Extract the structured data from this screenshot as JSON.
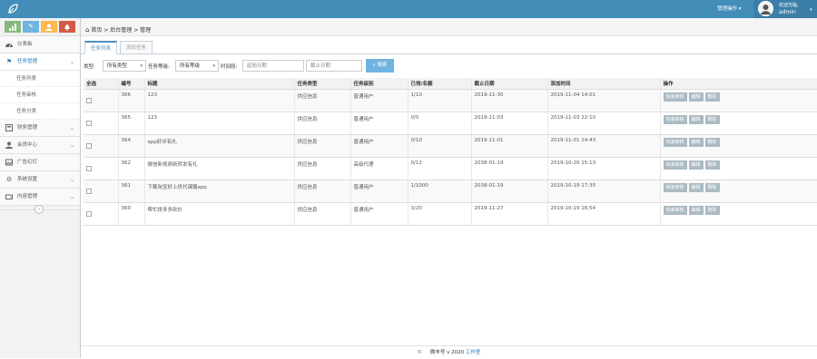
{
  "topbar": {
    "logo_icon": "leaf-icon",
    "admin_menu": "管理操作",
    "user_greeting": "欢迎光临,",
    "user_name": "admin"
  },
  "shortcuts": [
    {
      "icon": "signal-icon",
      "color": "#87b87f"
    },
    {
      "icon": "pencil-icon",
      "color": "#6fb3e0"
    },
    {
      "icon": "users-icon",
      "color": "#ffb752"
    },
    {
      "icon": "bell-icon",
      "color": "#d15b47"
    }
  ],
  "sidebar": {
    "dashboard": "仪表板",
    "task_mgmt": "任务管理",
    "task_list": "任务列表",
    "task_review": "任务审核",
    "task_category": "任务分类",
    "finance": "财务管理",
    "members": "会员中心",
    "ads": "广告幻灯",
    "settings": "系统设置",
    "content": "内容管理"
  },
  "breadcrumb": {
    "home": "首页",
    "sep": ">",
    "backend": "后台管理",
    "current": "管理"
  },
  "tabs": {
    "task_list": "任务列表",
    "add_task": "添加任务"
  },
  "filter": {
    "type_label": "类型:",
    "type_value": "所有类型",
    "level_label": "任务等级:",
    "level_value": "所有等级",
    "time_label": "时间段:",
    "start_placeholder": "起始日期",
    "end_placeholder": "截止日期",
    "search_button": "搜索"
  },
  "table": {
    "headers": {
      "select_all": "全选",
      "id": "编号",
      "title": "标题",
      "type": "任务类型",
      "level": "任务级别",
      "claimed": "已领/名额",
      "deadline": "截止日期",
      "added": "添加时间",
      "ops": "操作"
    },
    "rows": [
      {
        "id": "366",
        "title": "123",
        "type": "供应信息",
        "level": "普通用户",
        "claimed": "1/10",
        "deadline": "2019-11-30",
        "added": "2019-11-04 14:01"
      },
      {
        "id": "365",
        "title": "123",
        "type": "供应信息",
        "level": "普通用户",
        "claimed": "0/5",
        "deadline": "2019-11-03",
        "added": "2019-11-03 22:10"
      },
      {
        "id": "364",
        "title": "app好评有礼",
        "type": "供应信息",
        "level": "普通用户",
        "claimed": "0/10",
        "deadline": "2019-11-01",
        "added": "2019-11-01 14:43"
      },
      {
        "id": "362",
        "title": "微信新视频新转发有礼",
        "type": "供应信息",
        "level": "高级代理",
        "claimed": "0/12",
        "deadline": "2038-01-19",
        "added": "2019-10-20 15:13"
      },
      {
        "id": "361",
        "title": "下载淘宝好上供代课赠app",
        "type": "供应信息",
        "level": "普通用户",
        "claimed": "1/1000",
        "deadline": "2038-01-19",
        "added": "2019-10-19 17:35"
      },
      {
        "id": "360",
        "title": "帮忙拼多多砍价",
        "type": "供应信息",
        "level": "普通用户",
        "claimed": "3/20",
        "deadline": "2019-11-27",
        "added": "2019-10-19 16:54"
      }
    ],
    "op_review": "快速审核",
    "op_edit": "编辑",
    "op_delete": "删除"
  },
  "footer": {
    "icon": "copyright-icon",
    "text": "微丰号 v 2020",
    "link": "工作室"
  }
}
